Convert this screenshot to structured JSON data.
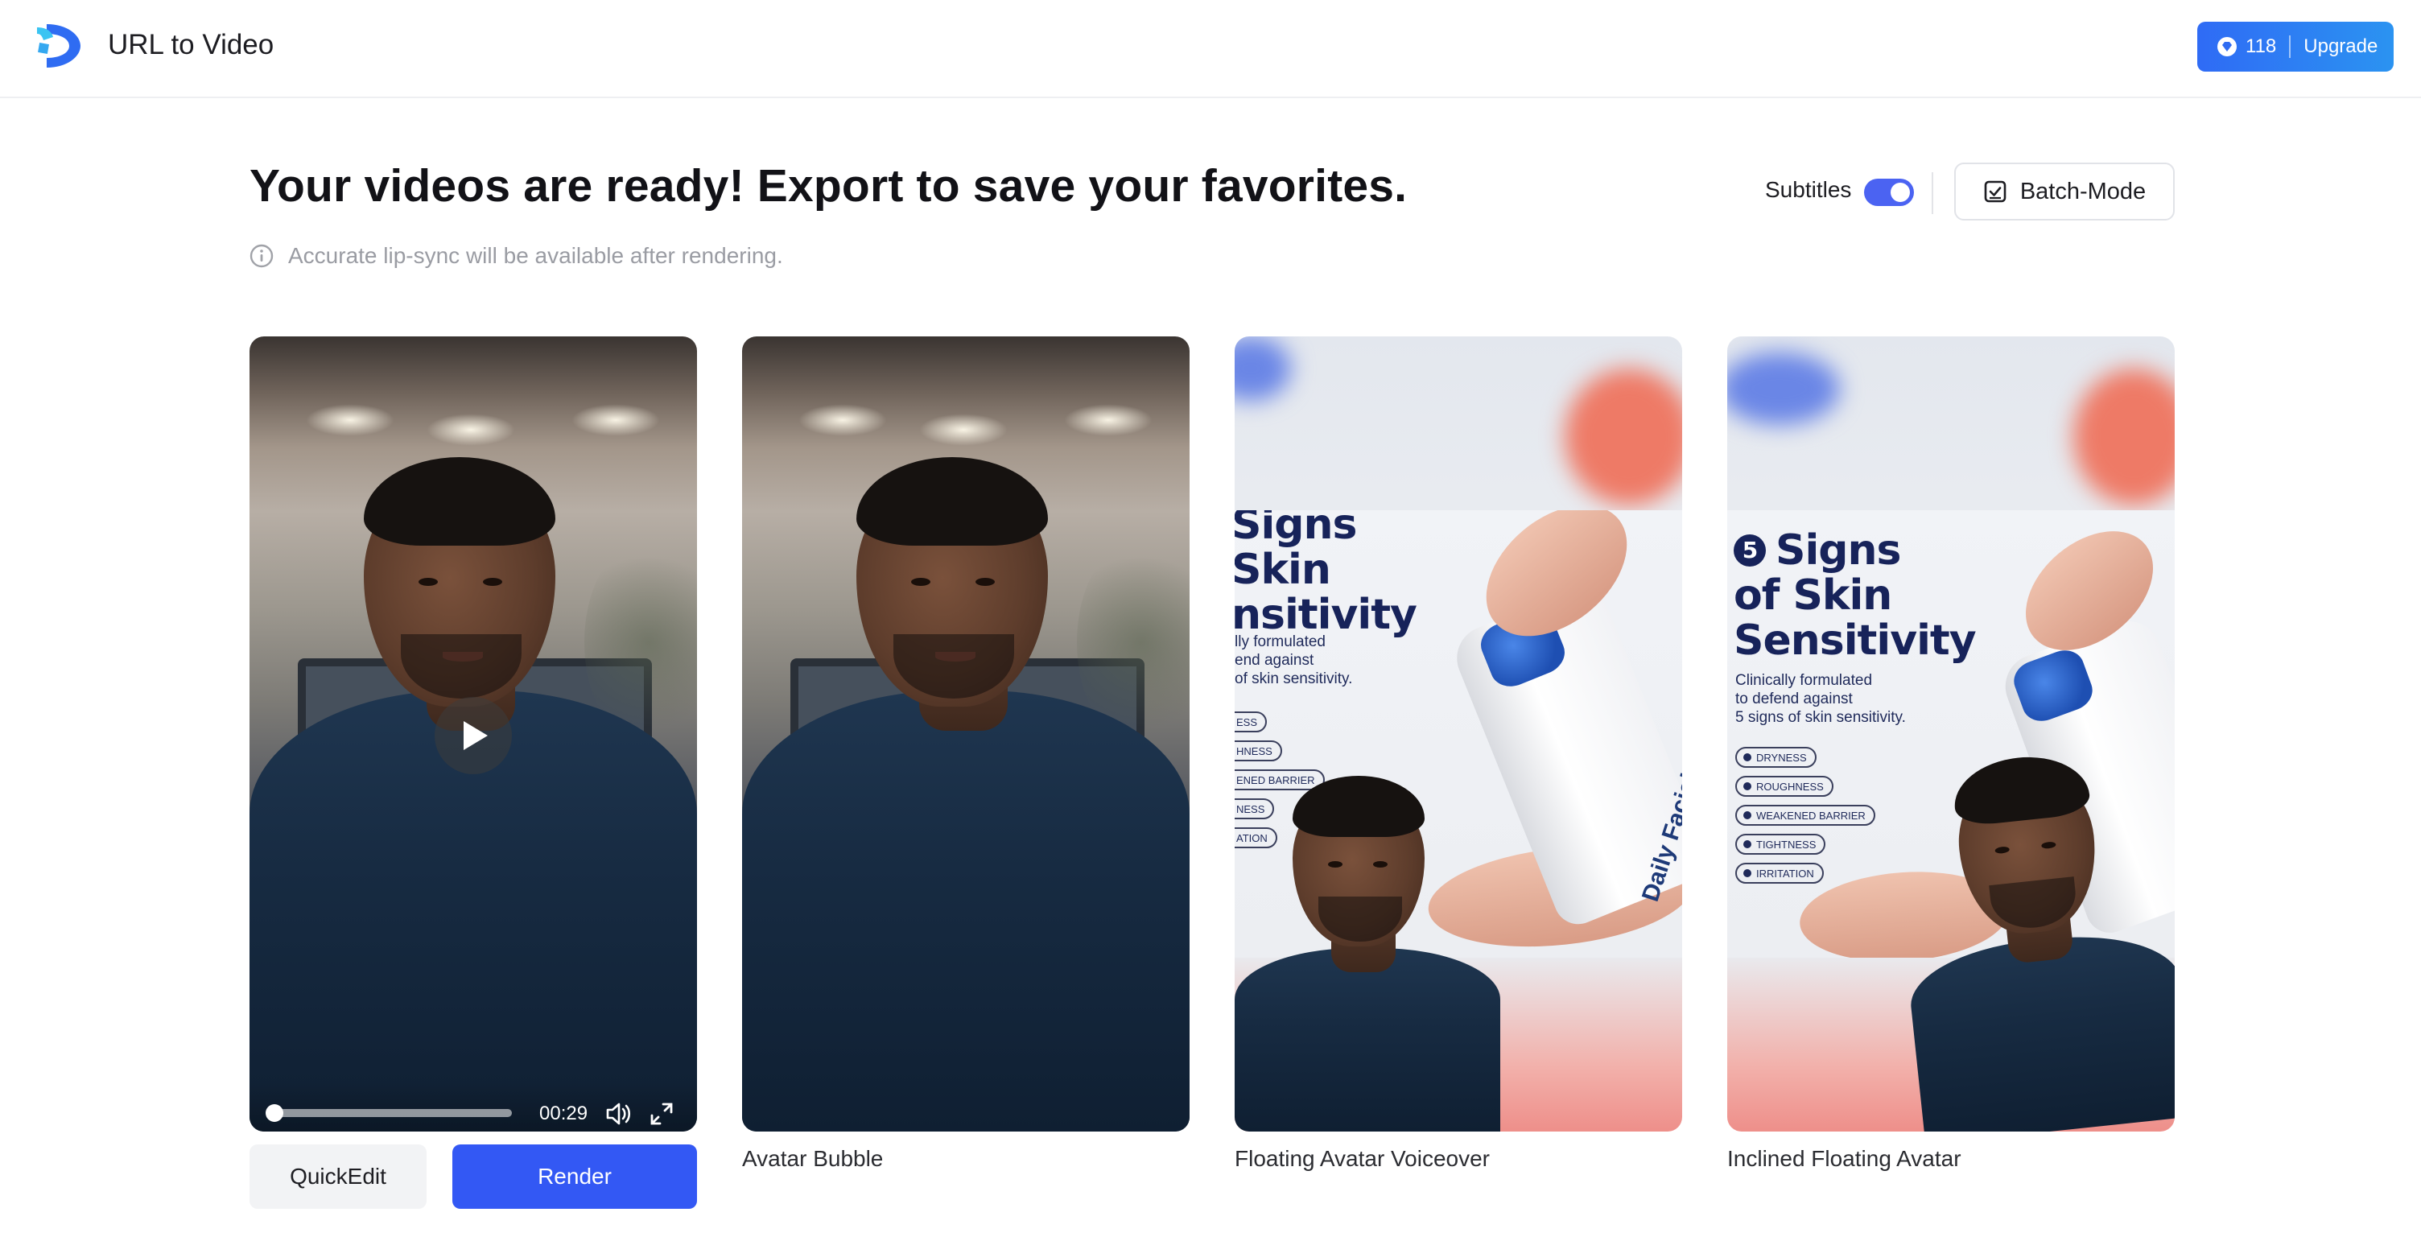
{
  "header": {
    "app_title": "URL to Video",
    "credits": "118",
    "upgrade_label": "Upgrade"
  },
  "main": {
    "headline": "Your videos are ready! Export to save your favorites.",
    "note": "Accurate lip-sync will be available after rendering.",
    "subtitles_label": "Subtitles",
    "subtitles_on": true,
    "batch_label": "Batch-Mode"
  },
  "player": {
    "time": "00:29",
    "progress": 0.0
  },
  "cards": [
    {
      "caption": ""
    },
    {
      "caption": "Avatar Bubble"
    },
    {
      "caption": "Floating Avatar Voiceover"
    },
    {
      "caption": "Inclined Floating Avatar"
    }
  ],
  "ad": {
    "title_cropped": [
      "Signs",
      "Skin",
      "nsitivity"
    ],
    "sub_cropped": [
      "lly formulated",
      "end against",
      "of skin sensitivity."
    ],
    "pills_cropped": [
      "ESS",
      "HNESS",
      "ENED BARRIER",
      "NESS",
      "ATION"
    ],
    "number": "5",
    "title": [
      "Signs",
      "of Skin",
      "Sensitivity"
    ],
    "sub": [
      "Clinically formulated",
      "to defend against",
      "5 signs of skin sensitivity."
    ],
    "pills": [
      "DRYNESS",
      "ROUGHNESS",
      "WEAKENED BARRIER",
      "TIGHTNESS",
      "IRRITATION"
    ],
    "bottle_text": "Daily Facial Cleanser"
  },
  "actions": {
    "quickedit": "QuickEdit",
    "render": "Render"
  },
  "colors": {
    "accent": "#3358f4",
    "toggle": "#4b63f2",
    "ad_navy": "#17235a"
  }
}
